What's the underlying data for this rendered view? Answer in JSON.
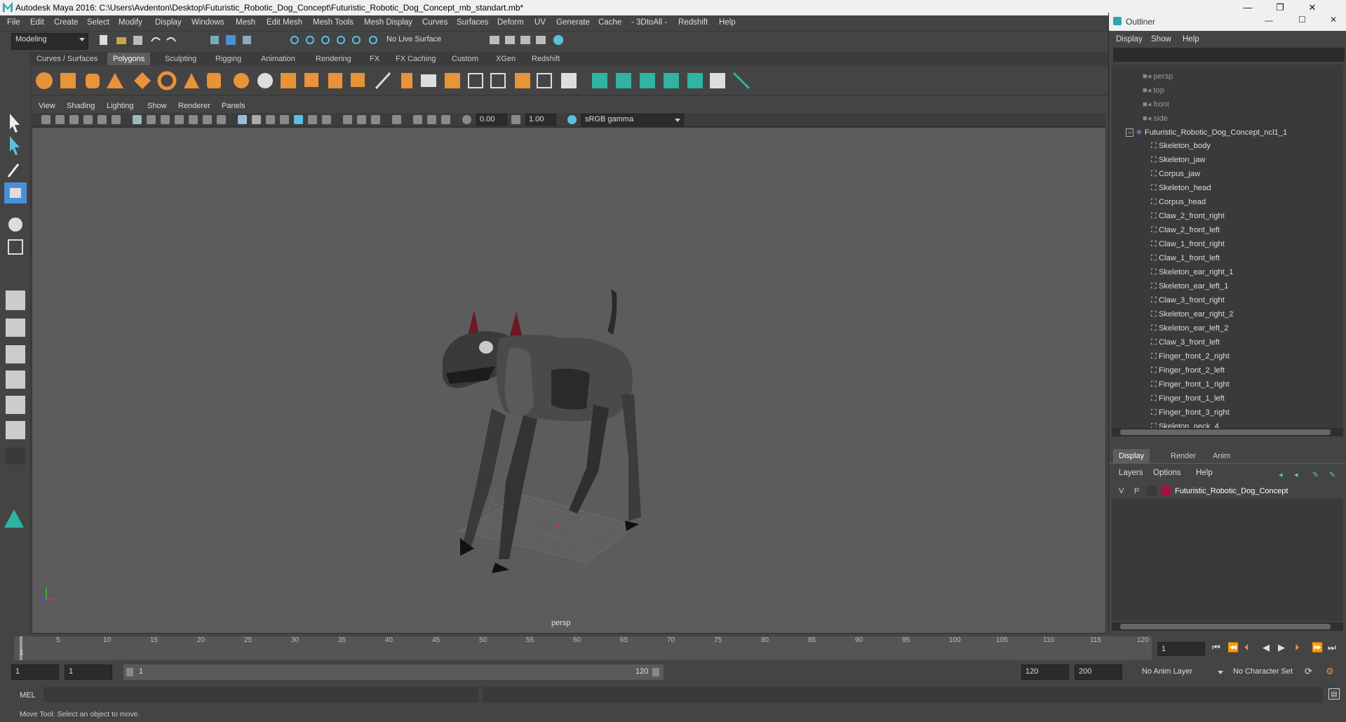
{
  "window": {
    "title": "Autodesk Maya 2016: C:\\Users\\Avdenton\\Desktop\\Futuristic_Robotic_Dog_Concept\\Futuristic_Robotic_Dog_Concept_mb_standart.mb*",
    "minimize": "—",
    "maximize": "❐",
    "close": "✕"
  },
  "menubar": [
    "File",
    "Edit",
    "Create",
    "Select",
    "Modify",
    "Display",
    "Windows",
    "Mesh",
    "Edit Mesh",
    "Mesh Tools",
    "Mesh Display",
    "Curves",
    "Surfaces",
    "Deform",
    "UV",
    "Generate",
    "Cache",
    "- 3DtoAll -",
    "Redshift",
    "Help"
  ],
  "statusline": {
    "mode": "Modeling",
    "live_surface": "No Live Surface"
  },
  "shelf_tabs": [
    "Curves / Surfaces",
    "Polygons",
    "Sculpting",
    "Rigging",
    "Animation",
    "Rendering",
    "FX",
    "FX Caching",
    "Custom",
    "XGen",
    "Redshift"
  ],
  "shelf_active": "Polygons",
  "viewport": {
    "menu": [
      "View",
      "Shading",
      "Lighting",
      "Show",
      "Renderer",
      "Panels"
    ],
    "exposure": "0.00",
    "gamma": "1.00",
    "color_space": "sRGB gamma",
    "camera_label": "persp"
  },
  "outliner": {
    "title": "Outliner",
    "menu": [
      "Display",
      "Show",
      "Help"
    ],
    "cameras": [
      "persp",
      "top",
      "front",
      "side"
    ],
    "root": "Futuristic_Robotic_Dog_Concept_ncl1_1",
    "children": [
      "Skeleton_body",
      "Skeleton_jaw",
      "Corpus_jaw",
      "Skeleton_head",
      "Corpus_head",
      "Claw_2_front_right",
      "Claw_2_front_left",
      "Claw_1_front_right",
      "Claw_1_front_left",
      "Skeleton_ear_right_1",
      "Skeleton_ear_left_1",
      "Claw_3_front_right",
      "Skeleton_ear_right_2",
      "Skeleton_ear_left_2",
      "Claw_3_front_left",
      "Finger_front_2_right",
      "Finger_front_2_left",
      "Finger_front_1_right",
      "Finger_front_1_left",
      "Finger_front_3_right",
      "Skeleton_neck_4"
    ]
  },
  "layer_editor": {
    "tabs": [
      "Display",
      "Render",
      "Anim"
    ],
    "active_tab": "Display",
    "menu": [
      "Layers",
      "Options",
      "Help"
    ],
    "layer": {
      "v": "V",
      "p": "P",
      "name": "Futuristic_Robotic_Dog_Concept",
      "color": "#a3123a"
    }
  },
  "timeline": {
    "ticks": [
      "5",
      "10",
      "15",
      "20",
      "25",
      "30",
      "35",
      "40",
      "45",
      "50",
      "55",
      "60",
      "65",
      "70",
      "75",
      "80",
      "85",
      "90",
      "95",
      "100",
      "105",
      "110",
      "115",
      "120"
    ],
    "start_tick": "1",
    "current_frame": "1"
  },
  "range": {
    "start": "1",
    "playback_start": "1",
    "slider_start": "1",
    "slider_end": "120",
    "playback_end": "120",
    "end": "200",
    "anim_layer": "No Anim Layer",
    "character_set": "No Character Set"
  },
  "cmdline": {
    "label": "MEL"
  },
  "helpline": {
    "text": "Move Tool: Select an object to move."
  },
  "colors": {
    "accent_orange": "#e8923a",
    "accent_teal": "#2fb3a3",
    "tool_active": "#4a90d9"
  }
}
